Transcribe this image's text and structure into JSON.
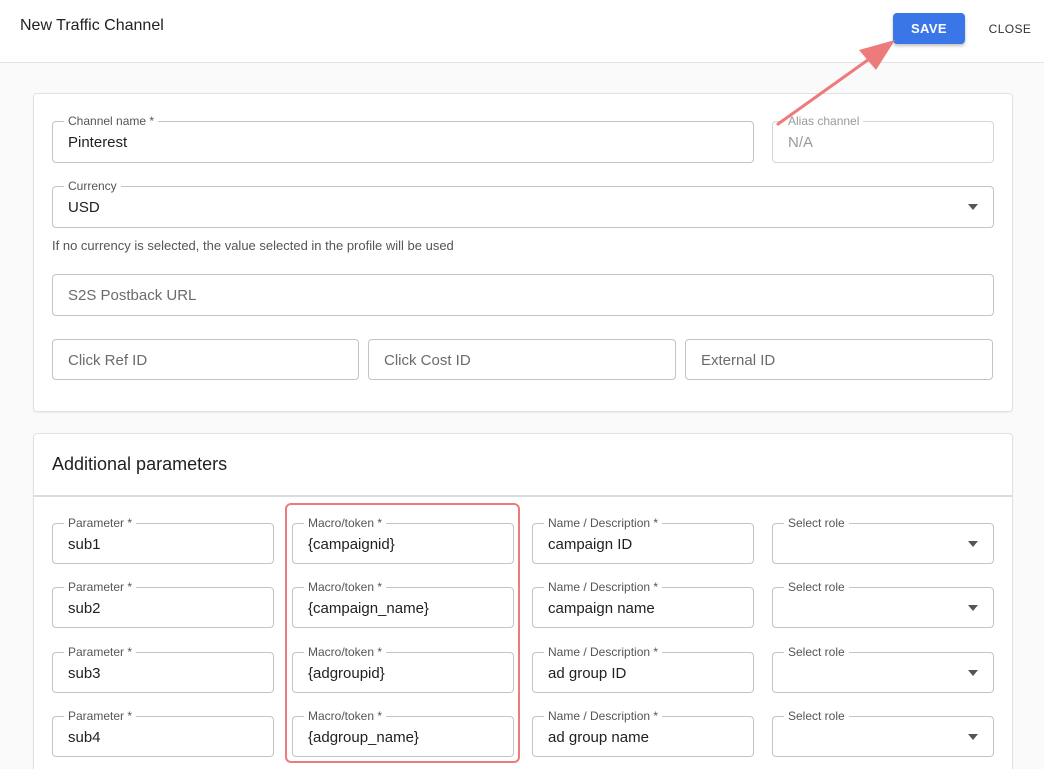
{
  "header": {
    "title": "New Traffic Channel",
    "save_label": "SAVE",
    "close_label": "CLOSE"
  },
  "form": {
    "channel_name": {
      "label": "Channel name *",
      "value": "Pinterest"
    },
    "alias_channel": {
      "label": "Alias channel",
      "value": "N/A"
    },
    "currency": {
      "label": "Currency",
      "value": "USD"
    },
    "currency_helper": "If no currency is selected, the value selected in the profile will be used",
    "postback_url": {
      "placeholder": "S2S Postback URL"
    },
    "click_ref_id": {
      "placeholder": "Click Ref ID"
    },
    "click_cost_id": {
      "placeholder": "Click Cost ID"
    },
    "external_id": {
      "placeholder": "External ID"
    }
  },
  "additional_parameters": {
    "title": "Additional parameters",
    "labels": {
      "parameter": "Parameter *",
      "macro": "Macro/token *",
      "name": "Name / Description *",
      "role": "Select role"
    },
    "rows": [
      {
        "parameter": "sub1",
        "macro": "{campaignid}",
        "name": "campaign ID",
        "role": ""
      },
      {
        "parameter": "sub2",
        "macro": "{campaign_name}",
        "name": "campaign name",
        "role": ""
      },
      {
        "parameter": "sub3",
        "macro": "{adgroupid}",
        "name": "ad group ID",
        "role": ""
      },
      {
        "parameter": "sub4",
        "macro": "{adgroup_name}",
        "name": "ad group name",
        "role": ""
      }
    ]
  },
  "colors": {
    "primary": "#3b76e9",
    "annotation": "#ee7b7b"
  }
}
